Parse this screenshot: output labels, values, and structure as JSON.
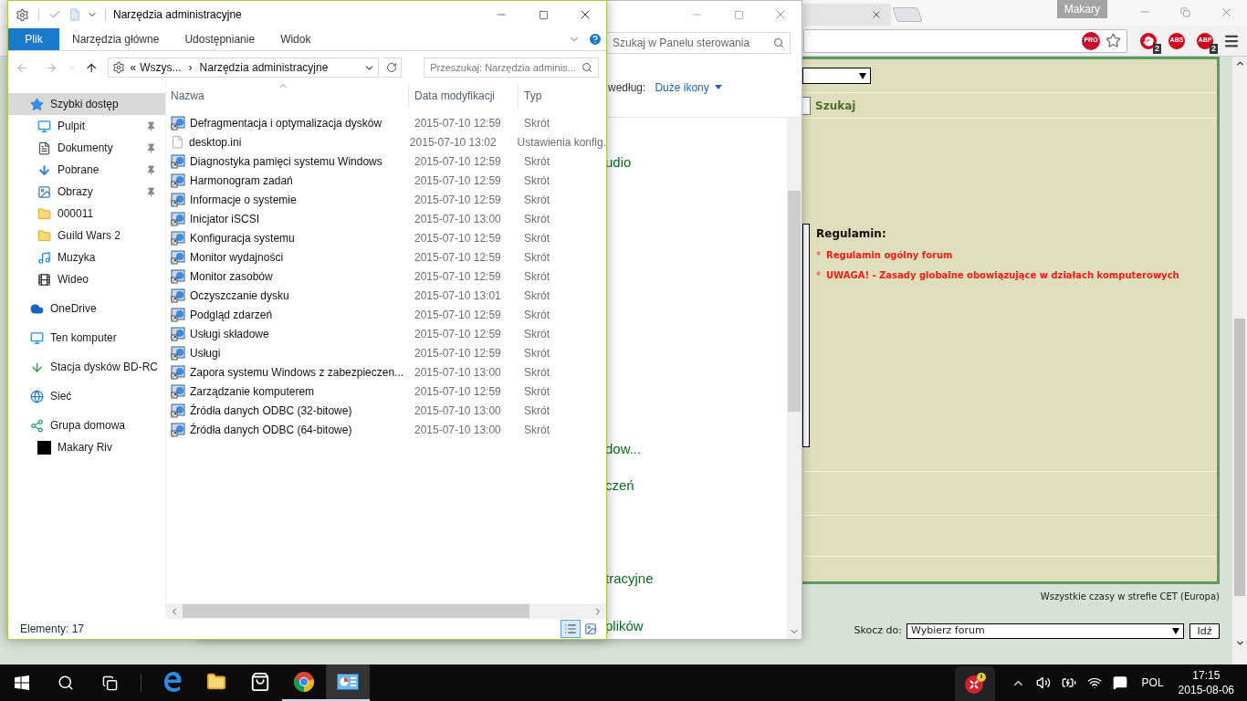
{
  "browser": {
    "profile": "Makary",
    "omnibox_badge": "PRO",
    "extensions": [
      {
        "kind": "hand",
        "badge": "2"
      },
      {
        "kind": "octagon",
        "label": "ABS"
      },
      {
        "kind": "octagon",
        "label": "ABP",
        "badge": "2"
      }
    ]
  },
  "forum": {
    "search_button": "Szukaj",
    "rules_title": "Regulamin:",
    "rules": [
      {
        "marker": "*",
        "text": "Regulamin ogólny forum"
      },
      {
        "marker": "*",
        "text": "UWAGA! - Zasady globalne obowiązujące w działach komputerowych"
      }
    ],
    "timezone": "Wszystkie czasy w strefie CET (Europa)",
    "jump_label": "Skocz do:",
    "jump_value": "Wybierz forum",
    "jump_button": "Idź"
  },
  "control_panel": {
    "search": {
      "placeholder": "Szukaj w Panelu sterowania"
    },
    "view_label": "według:",
    "view_value": "Duże ikony",
    "items": [
      "udio",
      "dow...",
      "czeń",
      "tracyjne",
      "plików"
    ]
  },
  "explorer": {
    "title": "Narzędzia administracyjne",
    "ribbon": [
      {
        "label": "Plik",
        "kind": "file"
      },
      {
        "label": "Narzędzia główne",
        "kind": "tab"
      },
      {
        "label": "Udostępnianie",
        "kind": "tab"
      },
      {
        "label": "Widok",
        "kind": "tab"
      }
    ],
    "address": {
      "prefix": "«",
      "crumbs": [
        "Wszys...",
        "Narzędzia administracyjne"
      ],
      "separator": "›"
    },
    "search": {
      "placeholder": "Przeszukaj: Narzędzia adminis..."
    },
    "nav": [
      {
        "label": "Szybki dostęp",
        "kind": "quick",
        "selected": true,
        "children": [
          {
            "label": "Pulpit",
            "kind": "desktop",
            "pinned": true,
            "selected": false
          },
          {
            "label": "Dokumenty",
            "kind": "documents",
            "pinned": true,
            "selected": false
          },
          {
            "label": "Pobrane",
            "kind": "downloads",
            "pinned": true,
            "selected": false
          },
          {
            "label": "Obrazy",
            "kind": "pictures",
            "pinned": true,
            "selected": false
          },
          {
            "label": "000011",
            "kind": "folder",
            "pinned": false,
            "selected": false
          },
          {
            "label": "Guild Wars 2",
            "kind": "folder",
            "pinned": false,
            "selected": false
          },
          {
            "label": "Muzyka",
            "kind": "music",
            "pinned": false,
            "selected": false
          },
          {
            "label": "Wideo",
            "kind": "video",
            "pinned": false,
            "selected": false
          }
        ]
      },
      {
        "label": "OneDrive",
        "kind": "cloud",
        "selected": false
      },
      {
        "label": "Ten komputer",
        "kind": "pc",
        "selected": false
      },
      {
        "label": "Stacja dysków BD-RC",
        "kind": "drive",
        "selected": false
      },
      {
        "label": "Sieć",
        "kind": "network",
        "selected": false
      },
      {
        "label": "Grupa domowa",
        "kind": "homegroup",
        "selected": false,
        "children": [
          {
            "label": "Makary Riv",
            "kind": "user",
            "selected": false
          }
        ]
      }
    ],
    "columns": [
      "Nazwa",
      "Data modyfikacji",
      "Typ"
    ],
    "rows": [
      {
        "kind": "shortcut",
        "name": "Defragmentacja i optymalizacja dysków",
        "date": "2015-07-10 12:59",
        "type": "Skrót"
      },
      {
        "kind": "settings",
        "name": "desktop.ini",
        "date": "2015-07-10 13:02",
        "type": "Ustawienia konfig."
      },
      {
        "kind": "shortcut",
        "name": "Diagnostyka pamięci systemu Windows",
        "date": "2015-07-10 12:59",
        "type": "Skrót"
      },
      {
        "kind": "shortcut",
        "name": "Harmonogram zadań",
        "date": "2015-07-10 12:59",
        "type": "Skrót"
      },
      {
        "kind": "shortcut",
        "name": "Informacje o systemie",
        "date": "2015-07-10 12:59",
        "type": "Skrót"
      },
      {
        "kind": "shortcut",
        "name": "Inicjator iSCSI",
        "date": "2015-07-10 13:00",
        "type": "Skrót"
      },
      {
        "kind": "shortcut",
        "name": "Konfiguracja systemu",
        "date": "2015-07-10 12:59",
        "type": "Skrót"
      },
      {
        "kind": "shortcut",
        "name": "Monitor wydajności",
        "date": "2015-07-10 12:59",
        "type": "Skrót"
      },
      {
        "kind": "shortcut",
        "name": "Monitor zasobów",
        "date": "2015-07-10 12:59",
        "type": "Skrót"
      },
      {
        "kind": "shortcut",
        "name": "Oczyszczanie dysku",
        "date": "2015-07-10 13:01",
        "type": "Skrót"
      },
      {
        "kind": "shortcut",
        "name": "Podgląd zdarzeń",
        "date": "2015-07-10 12:59",
        "type": "Skrót"
      },
      {
        "kind": "shortcut",
        "name": "Usługi składowe",
        "date": "2015-07-10 12:59",
        "type": "Skrót"
      },
      {
        "kind": "shortcut",
        "name": "Usługi",
        "date": "2015-07-10 12:59",
        "type": "Skrót"
      },
      {
        "kind": "shortcut",
        "name": "Zapora systemu Windows z zabezpieczen...",
        "date": "2015-07-10 13:00",
        "type": "Skrót"
      },
      {
        "kind": "shortcut",
        "name": "Zarządzanie komputerem",
        "date": "2015-07-10 12:59",
        "type": "Skrót"
      },
      {
        "kind": "shortcut",
        "name": "Źródła danych ODBC (32-bitowe)",
        "date": "2015-07-10 13:00",
        "type": "Skrót"
      },
      {
        "kind": "shortcut",
        "name": "Źródła danych ODBC (64-bitowe)",
        "date": "2015-07-10 13:00",
        "type": "Skrót"
      }
    ],
    "status": "Elementy: 17",
    "views": [
      {
        "kind": "details",
        "selected": true
      },
      {
        "kind": "large",
        "selected": false
      }
    ]
  },
  "taskbar": {
    "apps": [
      {
        "kind": "edge",
        "running": false,
        "active": false
      },
      {
        "kind": "explorer",
        "running": false,
        "active": false
      },
      {
        "kind": "store",
        "running": false,
        "active": false
      },
      {
        "kind": "chrome",
        "running": true,
        "active": false
      },
      {
        "kind": "control",
        "running": true,
        "active": true
      }
    ],
    "language": "POL",
    "time": "17:15",
    "date": "2015-08-06"
  }
}
